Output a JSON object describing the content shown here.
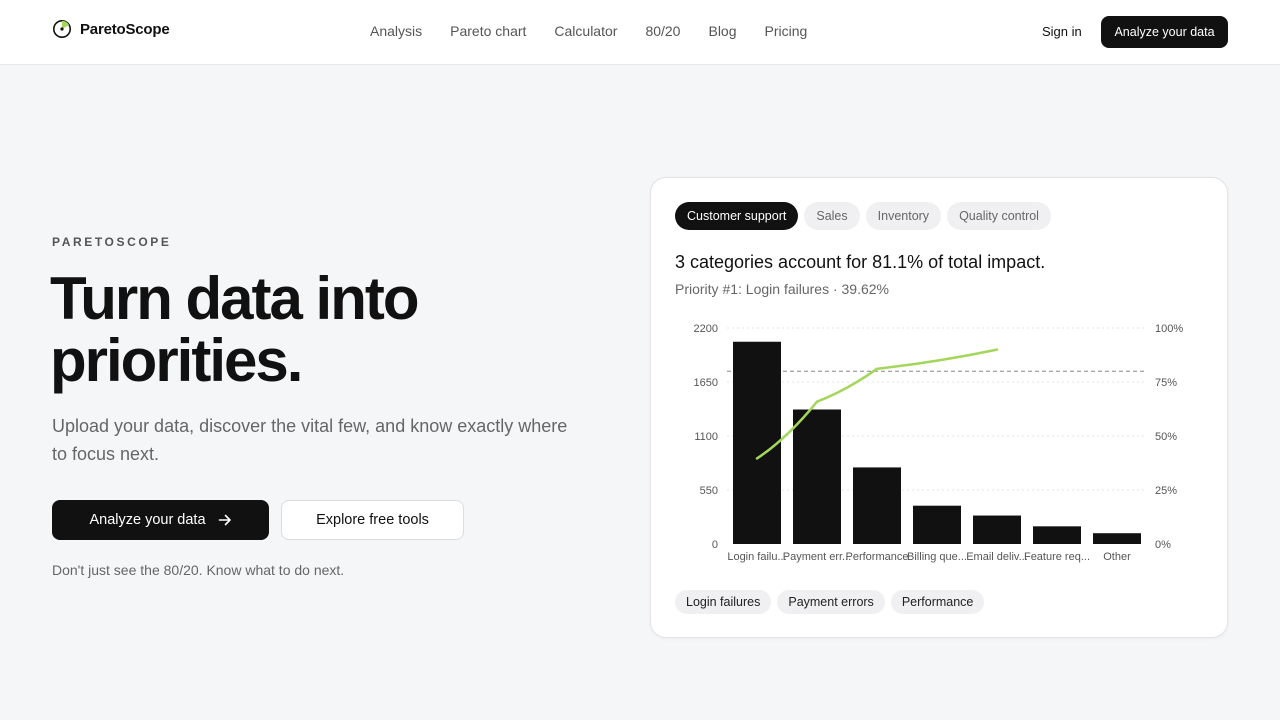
{
  "header": {
    "brand": "ParetoScope",
    "nav": [
      "Analysis",
      "Pareto chart",
      "Calculator",
      "80/20",
      "Blog",
      "Pricing"
    ],
    "sign_in": "Sign in",
    "cta": "Analyze your data"
  },
  "hero": {
    "eyebrow": "PARETOSCOPE",
    "headline": "Turn data into priorities.",
    "subhead": "Upload your data, discover the vital few, and know exactly where to focus next.",
    "primary_cta": "Analyze your data",
    "secondary_cta": "Explore free tools",
    "tagline": "Don't just see the 80/20. Know what to do next."
  },
  "card": {
    "tabs": [
      {
        "label": "Customer support",
        "active": true
      },
      {
        "label": "Sales",
        "active": false
      },
      {
        "label": "Inventory",
        "active": false
      },
      {
        "label": "Quality control",
        "active": false
      }
    ],
    "title": "3 categories account for 81.1% of total impact.",
    "subtitle": "Priority #1: Login failures · 39.62%",
    "chips": [
      "Login failures",
      "Payment errors",
      "Performance"
    ]
  },
  "colors": {
    "accent": "#a3d65a",
    "dark": "#111111"
  },
  "chart_data": {
    "type": "bar",
    "categories": [
      "Login failu...",
      "Payment err...",
      "Performance",
      "Billing que...",
      "Email deliv...",
      "Feature req...",
      "Other"
    ],
    "values": [
      2060,
      1370,
      780,
      390,
      290,
      180,
      110
    ],
    "cumulative_percent": [
      39.6,
      65.9,
      81.1,
      null,
      null,
      null,
      null
    ],
    "ylim": [
      0,
      2200
    ],
    "y_ticks": [
      0,
      550,
      1100,
      1650,
      2200
    ],
    "y2_ticks": [
      "0%",
      "25%",
      "50%",
      "75%",
      "100%"
    ],
    "threshold_percent": 80,
    "grid": true
  }
}
